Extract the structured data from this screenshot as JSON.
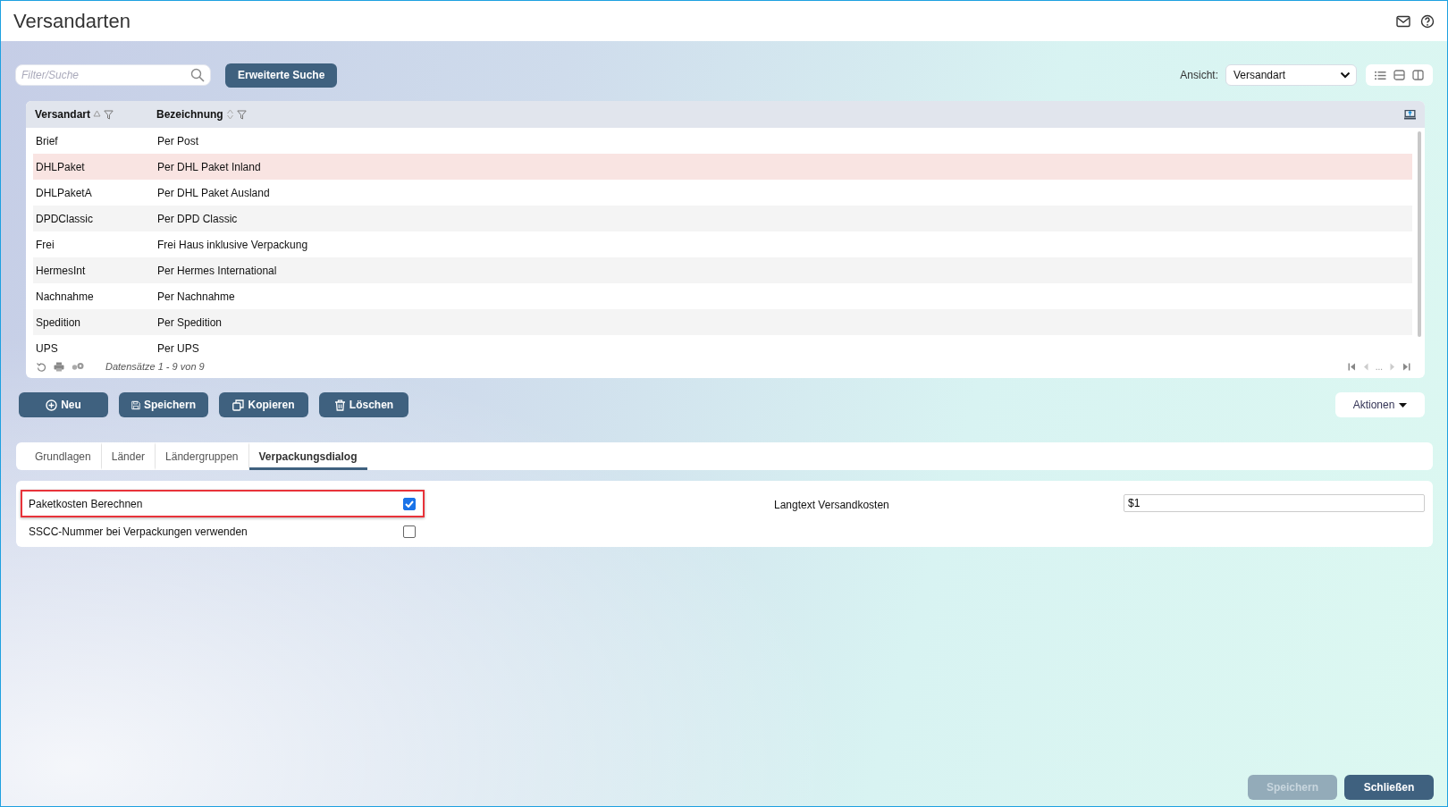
{
  "window": {
    "title": "Versandarten"
  },
  "toolbar": {
    "search": {
      "placeholder": "Filter/Suche"
    },
    "advanced_search_button": "Erweiterte Suche",
    "view_label": "Ansicht:",
    "view_select": "Versandart"
  },
  "table": {
    "columns": [
      {
        "label": "Versandart",
        "sorted": true
      },
      {
        "label": "Bezeichnung",
        "sorted": false
      }
    ],
    "rows": [
      {
        "cells": [
          "Brief",
          "Per Post"
        ],
        "selected": false
      },
      {
        "cells": [
          "DHLPaket",
          "Per DHL Paket Inland"
        ],
        "selected": true
      },
      {
        "cells": [
          "DHLPaketA",
          "Per DHL Paket Ausland"
        ],
        "selected": false
      },
      {
        "cells": [
          "DPDClassic",
          "Per DPD Classic"
        ],
        "selected": false
      },
      {
        "cells": [
          "Frei",
          "Frei Haus inklusive Verpackung"
        ],
        "selected": false
      },
      {
        "cells": [
          "HermesInt",
          "Per Hermes International"
        ],
        "selected": false
      },
      {
        "cells": [
          "Nachnahme",
          "Per Nachnahme"
        ],
        "selected": false
      },
      {
        "cells": [
          "Spedition",
          "Per Spedition"
        ],
        "selected": false
      },
      {
        "cells": [
          "UPS",
          "Per UPS"
        ],
        "selected": false
      }
    ],
    "footer": {
      "record_count": "Datensätze 1 - 9 von 9",
      "pager_ellipsis": "..."
    }
  },
  "actions": {
    "buttons": [
      {
        "label": "Neu",
        "kind": "new"
      },
      {
        "label": "Speichern",
        "kind": "save"
      },
      {
        "label": "Kopieren",
        "kind": "copy"
      },
      {
        "label": "Löschen",
        "kind": "delete"
      }
    ],
    "menu": "Aktionen"
  },
  "tabs": [
    {
      "label": "Grundlagen",
      "selected": false
    },
    {
      "label": "Länder",
      "selected": false
    },
    {
      "label": "Ländergruppen",
      "selected": false
    },
    {
      "label": "Verpackungsdialog",
      "selected": true
    }
  ],
  "form": {
    "checkboxes": [
      {
        "label": "Paketkosten Berechnen",
        "checked": true,
        "highlighted": true
      },
      {
        "label": "SSCC-Nummer bei Verpackungen verwenden",
        "checked": false,
        "highlighted": false
      }
    ],
    "field": {
      "label": "Langtext Versandkosten",
      "value": "$1"
    }
  },
  "footer_buttons": [
    {
      "label": "Speichern",
      "disabled": true
    },
    {
      "label": "Schließen",
      "disabled": false
    }
  ]
}
